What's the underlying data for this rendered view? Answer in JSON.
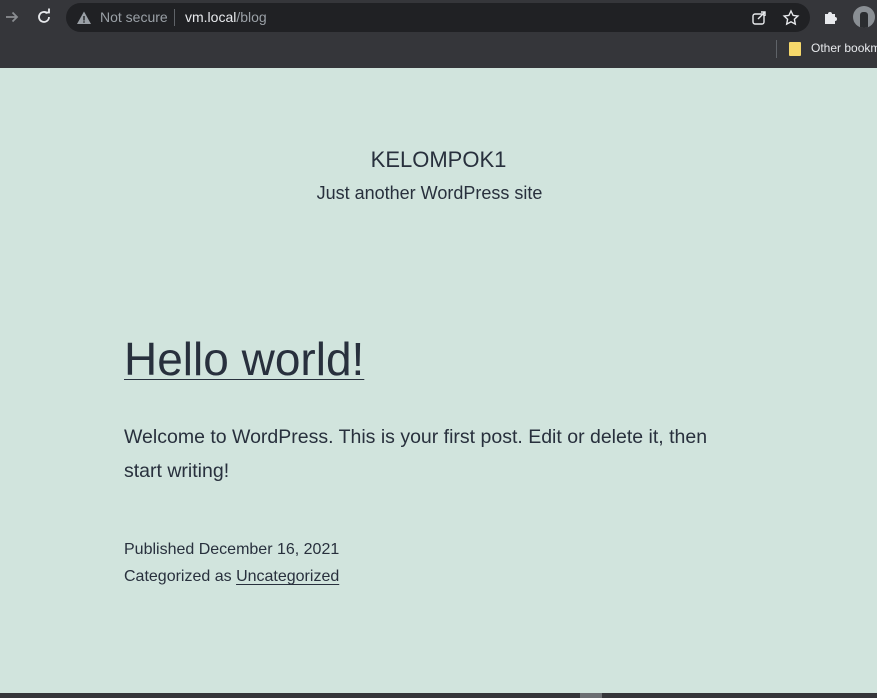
{
  "browser": {
    "security_label": "Not secure",
    "url_host": "vm.local",
    "url_path": "/blog",
    "bookmarks": {
      "other_label": "Other bookm"
    }
  },
  "site": {
    "title": "KELOMPOK1",
    "description": "Just another WordPress site"
  },
  "post": {
    "title": "Hello world!",
    "body": "Welcome to WordPress. This is your first post. Edit or delete it, then start writing!",
    "published_prefix": "Published ",
    "published_date": "December 16, 2021",
    "category_prefix": "Categorized as ",
    "category": "Uncategorized"
  },
  "colors": {
    "page_background": "#d1e4dd",
    "text": "#28303d",
    "chrome": "#35363a"
  }
}
